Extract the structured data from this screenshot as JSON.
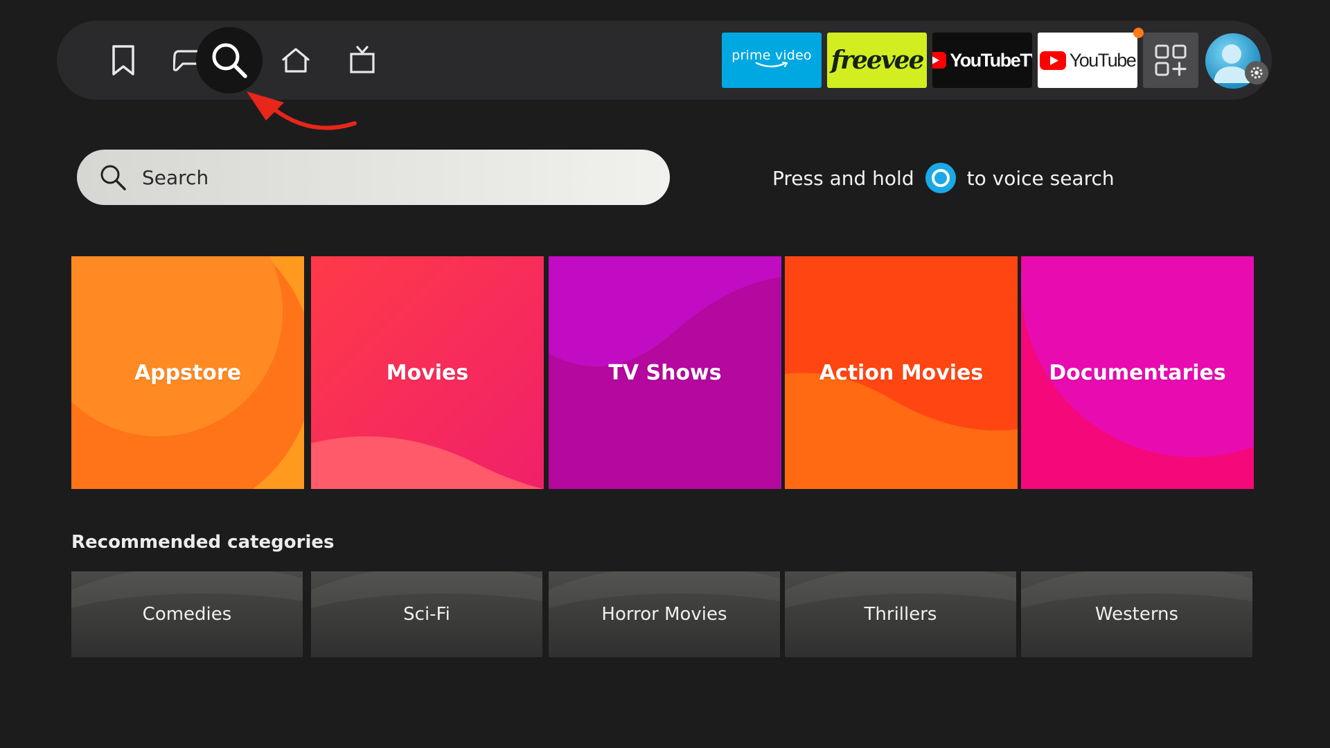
{
  "nav": {
    "icons": [
      "bookmark-icon",
      "game-controller-icon",
      "search-icon",
      "home-icon",
      "live-tv-icon"
    ],
    "active": "search-icon"
  },
  "apps": {
    "prime_video": "prime video",
    "freevee": "freevee",
    "youtube_tv": "YouTubeTV",
    "youtube": "YouTube",
    "more_apps_icon": "apps-grid-icon",
    "profile_icon": "profile-avatar-icon"
  },
  "search": {
    "placeholder": "Search",
    "voice_hint_before": "Press and hold",
    "voice_hint_after": "to voice search"
  },
  "categories": [
    {
      "label": "Appstore",
      "color": "#ff8a1e"
    },
    {
      "label": "Movies",
      "color": "#ff3e55"
    },
    {
      "label": "TV Shows",
      "color": "#bf0cbf"
    },
    {
      "label": "Action Movies",
      "color": "#ff5012"
    },
    {
      "label": "Documentaries",
      "color": "#ec0aa6"
    }
  ],
  "recommended": {
    "title": "Recommended categories",
    "items": [
      "Comedies",
      "Sci-Fi",
      "Horror Movies",
      "Thrillers",
      "Westerns"
    ]
  },
  "colors": {
    "background": "#1c1c1d",
    "annotation_arrow": "#e8261a",
    "alexa": "#1aa9e6"
  }
}
